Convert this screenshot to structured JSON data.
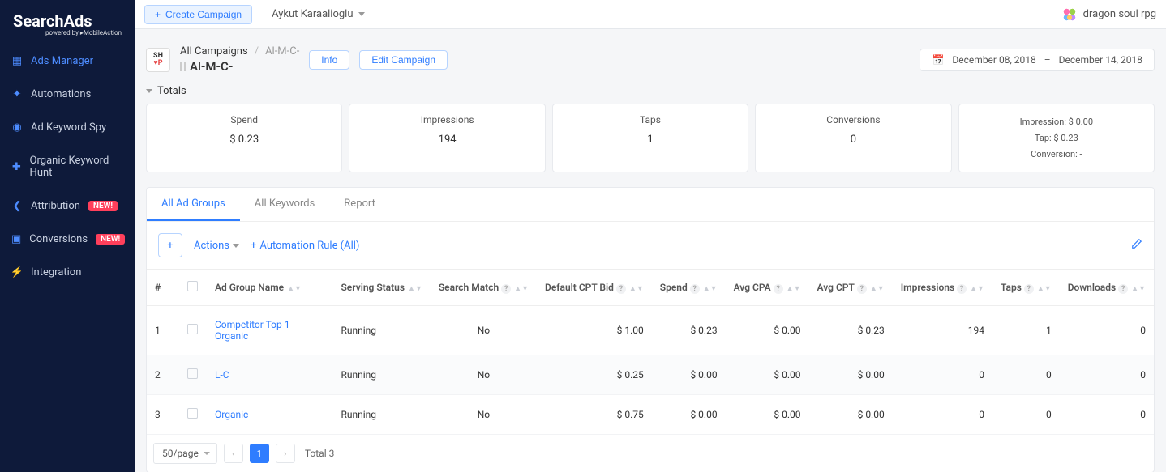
{
  "brand": {
    "name": "SearchAds",
    "powered": "powered by ▸MobileAction"
  },
  "sidebar": {
    "items": [
      {
        "label": "Ads Manager",
        "active": true
      },
      {
        "label": "Automations"
      },
      {
        "label": "Ad Keyword Spy"
      },
      {
        "label": "Organic Keyword Hunt"
      },
      {
        "label": "Attribution",
        "badge": "NEW!"
      },
      {
        "label": "Conversions",
        "badge": "NEW!"
      },
      {
        "label": "Integration"
      }
    ]
  },
  "topbar": {
    "create": "Create Campaign",
    "user": "Aykut Karaalioglu",
    "app": "dragon soul rpg"
  },
  "header": {
    "crumb_root": "All Campaigns",
    "crumb_current": "Al-M-C-",
    "campaign_name": "Al-M-C-",
    "info": "Info",
    "edit": "Edit Campaign",
    "date_from": "December 08, 2018",
    "date_sep": "–",
    "date_to": "December 14, 2018"
  },
  "totals": {
    "label": "Totals",
    "cards": [
      {
        "label": "Spend",
        "value": "$ 0.23"
      },
      {
        "label": "Impressions",
        "value": "194"
      },
      {
        "label": "Taps",
        "value": "1"
      },
      {
        "label": "Conversions",
        "value": "0"
      }
    ],
    "extra": {
      "impression": "Impression: $ 0.00",
      "tap": "Tap: $ 0.23",
      "conversion": "Conversion: -"
    }
  },
  "panel": {
    "tabs": [
      {
        "label": "All Ad Groups",
        "active": true
      },
      {
        "label": "All Keywords"
      },
      {
        "label": "Report"
      }
    ],
    "toolbar": {
      "actions": "Actions",
      "automation": "Automation Rule (All)"
    },
    "columns": {
      "idx": "#",
      "name": "Ad Group Name",
      "status": "Serving Status",
      "match": "Search Match",
      "bid": "Default CPT Bid",
      "spend": "Spend",
      "cpa": "Avg CPA",
      "cpt": "Avg CPT",
      "impr": "Impressions",
      "taps": "Taps",
      "dl": "Downloads"
    },
    "rows": [
      {
        "idx": "1",
        "name": "Competitor Top 1 Organic",
        "status": "Running",
        "match": "No",
        "bid": "$ 1.00",
        "spend": "$ 0.23",
        "cpa": "$ 0.00",
        "cpt": "$ 0.23",
        "impr": "194",
        "taps": "1",
        "dl": "0"
      },
      {
        "idx": "2",
        "name": "L-C",
        "status": "Running",
        "match": "No",
        "bid": "$ 0.25",
        "spend": "$ 0.00",
        "cpa": "$ 0.00",
        "cpt": "$ 0.00",
        "impr": "0",
        "taps": "0",
        "dl": "0"
      },
      {
        "idx": "3",
        "name": "Organic",
        "status": "Running",
        "match": "No",
        "bid": "$ 0.75",
        "spend": "$ 0.00",
        "cpa": "$ 0.00",
        "cpt": "$ 0.00",
        "impr": "0",
        "taps": "0",
        "dl": "0"
      }
    ],
    "pagination": {
      "per": "50/page",
      "page": "1",
      "total": "Total 3"
    }
  }
}
